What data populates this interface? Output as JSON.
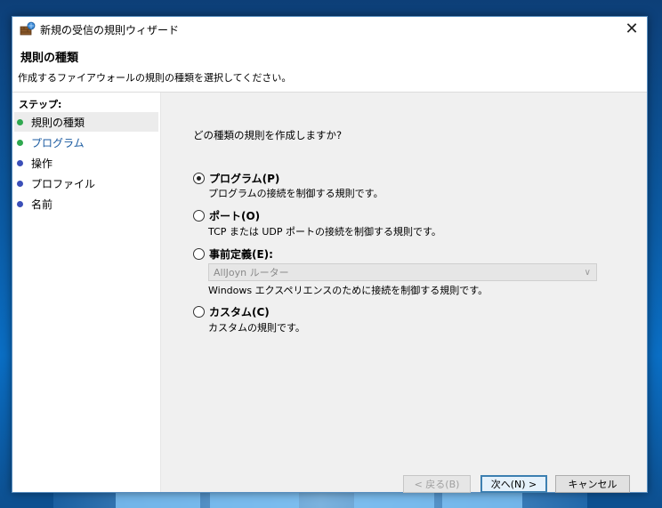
{
  "window": {
    "title": "新規の受信の規則ウィザード",
    "close_glyph": "✕"
  },
  "header": {
    "title": "規則の種類",
    "subtitle": "作成するファイアウォールの規則の種類を選択してください。"
  },
  "steps": {
    "heading": "ステップ:",
    "items": [
      {
        "label": "規則の種類",
        "state": "current",
        "dot_color": "#2fa84f"
      },
      {
        "label": "プログラム",
        "state": "next",
        "dot_color": "#2fa84f",
        "text_color": "#1a5aa0"
      },
      {
        "label": "操作",
        "state": "pending",
        "dot_color": "#3b4fb8"
      },
      {
        "label": "プロファイル",
        "state": "pending",
        "dot_color": "#3b4fb8"
      },
      {
        "label": "名前",
        "state": "pending",
        "dot_color": "#3b4fb8"
      }
    ]
  },
  "main": {
    "question": "どの種類の規則を作成しますか?",
    "options": [
      {
        "label": "プログラム(P)",
        "description": "プログラムの接続を制御する規則です。",
        "checked": true
      },
      {
        "label": "ポート(O)",
        "description": "TCP または UDP ポートの接続を制御する規則です。",
        "checked": false
      },
      {
        "label": "事前定義(E):",
        "description": "Windows エクスペリエンスのために接続を制御する規則です。",
        "checked": false
      },
      {
        "label": "カスタム(C)",
        "description": "カスタムの規則です。",
        "checked": false
      }
    ],
    "predefined_select": {
      "value": "AllJoyn ルーター",
      "arrow": "∨"
    }
  },
  "buttons": {
    "back": "< 戻る(B)",
    "next": "次へ(N) >",
    "cancel": "キャンセル"
  }
}
